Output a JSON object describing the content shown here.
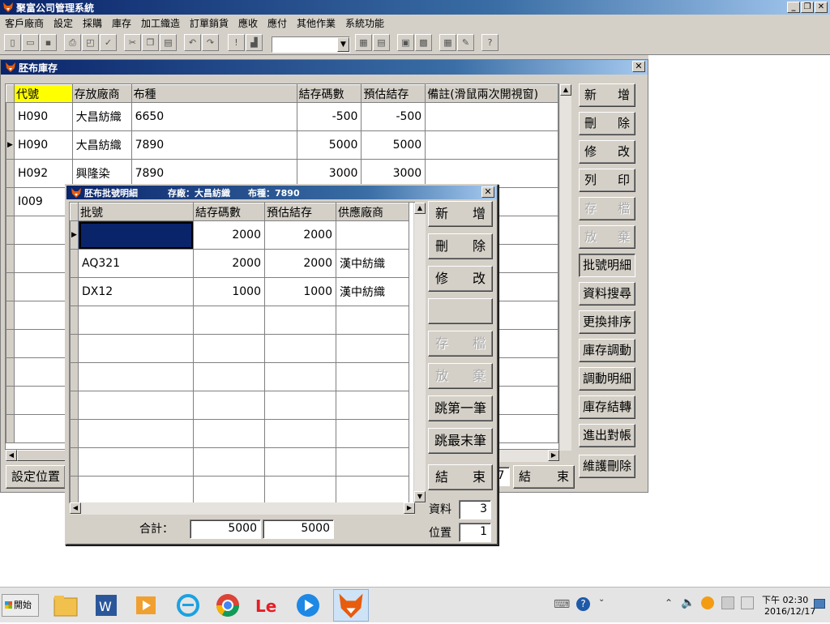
{
  "app": {
    "title": "聚富公司管理系統",
    "menu": [
      "客戶廠商",
      "設定",
      "採購",
      "庫存",
      "加工織造",
      "訂單銷貨",
      "應收",
      "應付",
      "其他作業",
      "系統功能"
    ]
  },
  "stock_window": {
    "title": "胚布庫存",
    "columns": [
      "代號",
      "存放廠商",
      "布種",
      "結存碼數",
      "預估結存",
      "備註(滑鼠兩次開視窗)"
    ],
    "rows": [
      {
        "code": "H090",
        "vendor": "大昌紡織",
        "fabric": "6650",
        "balance": "-500",
        "estimate": "-500",
        "note": ""
      },
      {
        "code": "H090",
        "vendor": "大昌紡織",
        "fabric": "7890",
        "balance": "5000",
        "estimate": "5000",
        "note": ""
      },
      {
        "code": "H092",
        "vendor": "興隆染",
        "fabric": "7890",
        "balance": "3000",
        "estimate": "3000",
        "note": ""
      },
      {
        "code": "I009",
        "vendor": "",
        "fabric": "",
        "balance": "",
        "estimate": "",
        "note": ""
      }
    ],
    "buttons": [
      {
        "label": "新增",
        "state": "normal"
      },
      {
        "label": "刪除",
        "state": "normal"
      },
      {
        "label": "修改",
        "state": "normal"
      },
      {
        "label": "列印",
        "state": "normal"
      },
      {
        "label": "存檔",
        "state": "disabled"
      },
      {
        "label": "放棄",
        "state": "disabled"
      },
      {
        "label": "批號明細",
        "state": "pressed"
      },
      {
        "label": "資料搜尋",
        "state": "normal"
      },
      {
        "label": "更換排序",
        "state": "normal"
      },
      {
        "label": "庫存調動",
        "state": "normal"
      },
      {
        "label": "調動明細",
        "state": "normal"
      },
      {
        "label": "庫存結轉",
        "state": "normal"
      },
      {
        "label": "進出對帳",
        "state": "normal"
      },
      {
        "label": "維護刪除",
        "state": "normal"
      }
    ],
    "set_position_label": "設定位置",
    "partial_count": "7",
    "end_label": "結束"
  },
  "batch_window": {
    "title": "胚布批號明細",
    "subtitle": "存廠：大昌紡織　　布種：7890",
    "columns": [
      "批號",
      "結存碼數",
      "預估結存",
      "供應廠商"
    ],
    "rows": [
      {
        "lot": "",
        "balance": "2000",
        "estimate": "2000",
        "supplier": ""
      },
      {
        "lot": "AQ321",
        "balance": "2000",
        "estimate": "2000",
        "supplier": "漢中紡織"
      },
      {
        "lot": "DX12",
        "balance": "1000",
        "estimate": "1000",
        "supplier": "漢中紡織"
      }
    ],
    "buttons": [
      {
        "label": "新增",
        "state": "normal"
      },
      {
        "label": "刪除",
        "state": "normal"
      },
      {
        "label": "修改",
        "state": "normal"
      },
      {
        "label": "",
        "state": "normal"
      },
      {
        "label": "存檔",
        "state": "disabled"
      },
      {
        "label": "放棄",
        "state": "disabled"
      },
      {
        "label": "跳第一筆",
        "state": "normal"
      },
      {
        "label": "跳最末筆",
        "state": "normal"
      },
      {
        "label": "結束",
        "state": "normal"
      }
    ],
    "total_label": "合計：",
    "total_balance": "5000",
    "total_estimate": "5000",
    "record_label": "資料",
    "record_count": "3",
    "position_label": "位置",
    "position_value": "1"
  },
  "taskbar": {
    "start_label": "開始",
    "time": "下午 02:30",
    "date": "2016/12/17"
  },
  "colors": {
    "title_bar": "#0a246a",
    "window_face": "#d4d0c8",
    "header_highlight": "#ffff00",
    "selected_cell": "#0a246a"
  }
}
